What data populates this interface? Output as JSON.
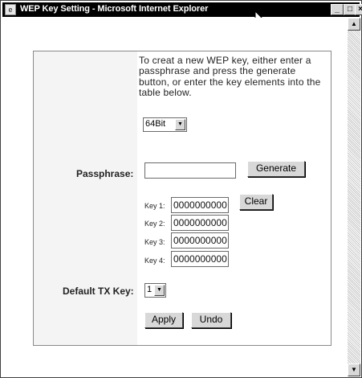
{
  "window": {
    "title": "WEP Key Setting - Microsoft Internet Explorer",
    "minimize_glyph": "_",
    "maximize_glyph": "□",
    "close_glyph": "×"
  },
  "scrollbar": {
    "up_glyph": "▲",
    "down_glyph": "▼"
  },
  "form": {
    "instructions": "To creat a new WEP key, either enter a passphrase and press the generate button, or enter the key elements into the table below.",
    "key_length": {
      "selected": "64Bit"
    },
    "passphrase": {
      "label": "Passphrase:",
      "value": "",
      "generate_label": "Generate"
    },
    "keys": [
      {
        "label": "Key 1:",
        "value": "0000000000"
      },
      {
        "label": "Key 2:",
        "value": "0000000000"
      },
      {
        "label": "Key 3:",
        "value": "0000000000"
      },
      {
        "label": "Key 4:",
        "value": "0000000000"
      }
    ],
    "clear_label": "Clear",
    "default_tx": {
      "label": "Default TX Key:",
      "selected": "1"
    },
    "apply_label": "Apply",
    "undo_label": "Undo"
  },
  "colors": {
    "title_bar": "#000000",
    "button_face": "#d8d8d8",
    "panel_bg": "#f4f4f4"
  }
}
